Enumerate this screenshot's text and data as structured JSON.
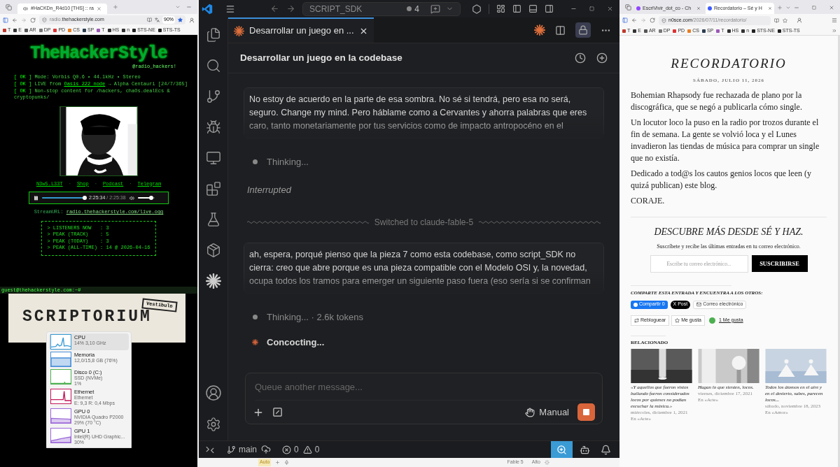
{
  "left_browser": {
    "tab_title": "#HaCKDn_R4d10 [THS] :: ra",
    "url_host": "radio.",
    "url_domain": "thehackerstyle.com",
    "zoom": "90%",
    "bookmarks": [
      "T",
      "E",
      "AR",
      "DP",
      "PD",
      "CS",
      "SP",
      "T",
      "HS",
      "n",
      "STS-NE",
      "STS-TS"
    ],
    "site": {
      "logo": "TheHackerStyle",
      "handle": "@radio_hackers!",
      "status_lines": [
        {
          "tag": "[ OK ]",
          "text": "Mode: Vorbis Q0.6 • 44.1kHz • Stereo"
        },
        {
          "tag": "[ OK ]",
          "text": "LIVE from",
          "link": "Oasis 222 node",
          "rest": "→ Alpha Centauri [24/7/365]"
        },
        {
          "tag": "[ OK ]",
          "text": "Non-stop content for /hackers, chaOs.dealEcs & cryptopunks/"
        }
      ],
      "links": [
        "N3w5.L33T",
        "Shop",
        "Podcast",
        "Telegram"
      ],
      "link_separator": "·",
      "player": {
        "playing": true,
        "level": 0.98,
        "time": "2:25:34",
        "duration": "/ 2:25:38",
        "volume": {
          "level": 0.8
        }
      },
      "stream_label": "StreamURL:",
      "stream_url": "radio.thehackerstyle.com/live.ogg",
      "stats": [
        {
          "label": "> LISTENERS NOW   :",
          "value": "3"
        },
        {
          "label": "> PEAK (TRACK)    :",
          "value": "5"
        },
        {
          "label": "> PEAK (TODAY)    :",
          "value": "3"
        },
        {
          "label": "> PEAK (ALL-TIME) :",
          "value": "14 @ 2026-04-16"
        }
      ]
    },
    "terminal_prompt": "guest@thehackerstyle.com:~#"
  },
  "scriptorium": {
    "title": "SCRIPTORIUM",
    "stamp": "Vestibulo"
  },
  "performance_flyout": {
    "items": [
      {
        "name": "CPU",
        "lines": [
          "14% 3,10 GHz"
        ],
        "selected": true,
        "color": "#3a9bd5"
      },
      {
        "name": "Memoria",
        "lines": [
          "12,0/15,8 GB (76%)"
        ],
        "selected": false,
        "color": "#4a8fd8"
      },
      {
        "name": "Disco 0 (C:)",
        "lines": [
          "SSD (NVMe)",
          "1%"
        ],
        "selected": false,
        "color": "#4caf50"
      },
      {
        "name": "Ethernet",
        "lines": [
          "Ethernet",
          "E: 9,3 R: 0,4 Mbps"
        ],
        "selected": false,
        "color": "#c2185b"
      },
      {
        "name": "GPU 0",
        "lines": [
          "NVIDIA Quadro P2000",
          "29% (70 °C)"
        ],
        "selected": false,
        "color": "#9c6ad8"
      },
      {
        "name": "GPU 1",
        "lines": [
          "Intel(R) UHD Graphic...",
          "30%"
        ],
        "selected": false,
        "color": "#9c6ad8"
      }
    ]
  },
  "editor": {
    "title": "SCRIPT_SDK",
    "changes": "4",
    "tabs": [
      {
        "label": "Desarrollar un juego en ...",
        "selected": true
      }
    ],
    "chat_title": "Desarrollar un juego en la codebase",
    "messages": [
      {
        "kind": "user",
        "text": "No estoy de acuerdo en la parte de esa sombra. No sé si tendrá, pero esa no será, seguro. Change my mind. Pero háblame como a Cervantes y ahorra palabras que eres caro, tanto monetariamente por tus servicios como de impacto antropocéno en el"
      },
      {
        "kind": "thinking",
        "text": "Thinking..."
      },
      {
        "kind": "interrupted",
        "text": "Interrupted"
      },
      {
        "kind": "divider",
        "text": "Switched to claude-fable-5"
      },
      {
        "kind": "user",
        "text": "ah, espera, porqué pienso que la pieza 7 como esta codebase, como script_SDK no cierra: creo que abre porque es una pieza compatible con el Modelo OSI y, la novedad, ocupa todos los tramos para emerger un siguiente paso fuera (eso sería si se confirman"
      },
      {
        "kind": "thinking",
        "text": "Thinking... · 2.6k tokens"
      },
      {
        "kind": "working",
        "text": "Concocting..."
      }
    ],
    "input_placeholder": "Queue another message...",
    "mode": "Manual",
    "status_bar": {
      "branch": "main",
      "errors": "0",
      "warnings": "0"
    },
    "below_strip": {
      "auto": "Auto",
      "model": "Fable 5",
      "effort": "Alto"
    }
  },
  "right_browser": {
    "tabs": [
      {
        "title": "EscriVivir_dot_co - Ch",
        "selected": false
      },
      {
        "title": "Recordatorio – Sé y H",
        "selected": true
      }
    ],
    "url_host": "n0sce.com",
    "url_path": "/2026/07/11/recordatorio/",
    "bookmarks": [
      "T",
      "E",
      "AR",
      "DP",
      "PD",
      "CS",
      "SP",
      "T",
      "HS",
      "n",
      "STS-NE",
      "STS-TS"
    ],
    "post": {
      "title": "RECORDATORIO",
      "date": "SÁBADO, JULIO 11, 2026",
      "paragraphs": [
        "Bohemian Rhapsody fue rechazada de plano por la discográfica, que se negó a publicarla cómo single.",
        "Un locutor loco la puso en la radio por trozos durante el fin de semana. La gente se volvió loca y el Lunes invadieron las tiendas de música para comprar un single que no existía.",
        "Dedicado a tod@s los cautos genios locos que leen (y quizá publican) este blog.",
        "CORAJE."
      ]
    },
    "subscribe": {
      "heading": "DESCUBRE MÁS DESDE SÉ Y HAZ.",
      "text": "Suscríbete y recibe las últimas entradas en tu correo electrónico.",
      "placeholder": "Escribe tu correo electrónico...",
      "button": "SUSCRIBIRSE"
    },
    "share": {
      "heading": "COMPARTE ESTA ENTRADA Y ENCUENTRA A LOS OTROS:",
      "buttons": [
        {
          "kind": "facebook",
          "label": "Compartir 0"
        },
        {
          "kind": "x",
          "label": "X Post"
        },
        {
          "kind": "email",
          "label": "Correo electrónico"
        }
      ]
    },
    "actions": {
      "reblog": "Rebloguear",
      "like": "Me gusta",
      "likes": "1 Me gusta"
    },
    "related": {
      "heading": "RELACIONADO",
      "items": [
        {
          "title": "«Y aquellos que fueron vistos bailando fueron considerados locos por quienes no podían escuchar la música.»",
          "date": "miércoles, diciembre 1, 2021",
          "category": "En «Arte»"
        },
        {
          "title": "Hagan lo que sienten, locos.",
          "date": "viernes, diciembre 17, 2021",
          "category": "En «Arte»"
        },
        {
          "title": "Todos los átomos en el aire y en el desierto, sabes, parecen locos...",
          "date": "sábado, noviembre 18, 2023",
          "category": "En «Amor»"
        }
      ]
    }
  }
}
